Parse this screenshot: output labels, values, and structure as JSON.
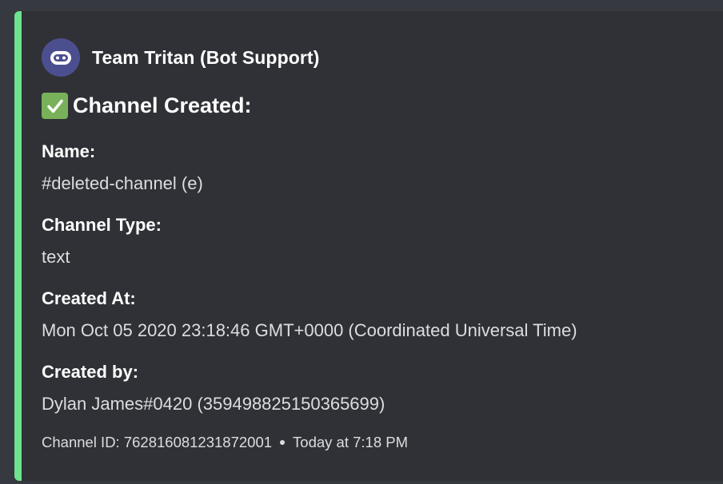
{
  "embed": {
    "accent_color": "#6fe28f",
    "author": {
      "name": "Team Tritan (Bot Support)",
      "avatar_icon": "robot-bot-icon"
    },
    "title": {
      "emoji_icon": "white-check-mark-icon",
      "text": "Channel Created:"
    },
    "fields": [
      {
        "name": "Name:",
        "value": "#deleted-channel (e)"
      },
      {
        "name": "Channel Type:",
        "value": "text"
      },
      {
        "name": "Created At:",
        "value": "Mon Oct 05 2020 23:18:46 GMT+0000 (Coordinated Universal Time)"
      },
      {
        "name": "Created by:",
        "value": "Dylan James#0420 (359498825150365699)"
      }
    ],
    "footer": {
      "text": "Channel ID: 762816081231872001",
      "timestamp": "Today at 7:18 PM"
    }
  }
}
